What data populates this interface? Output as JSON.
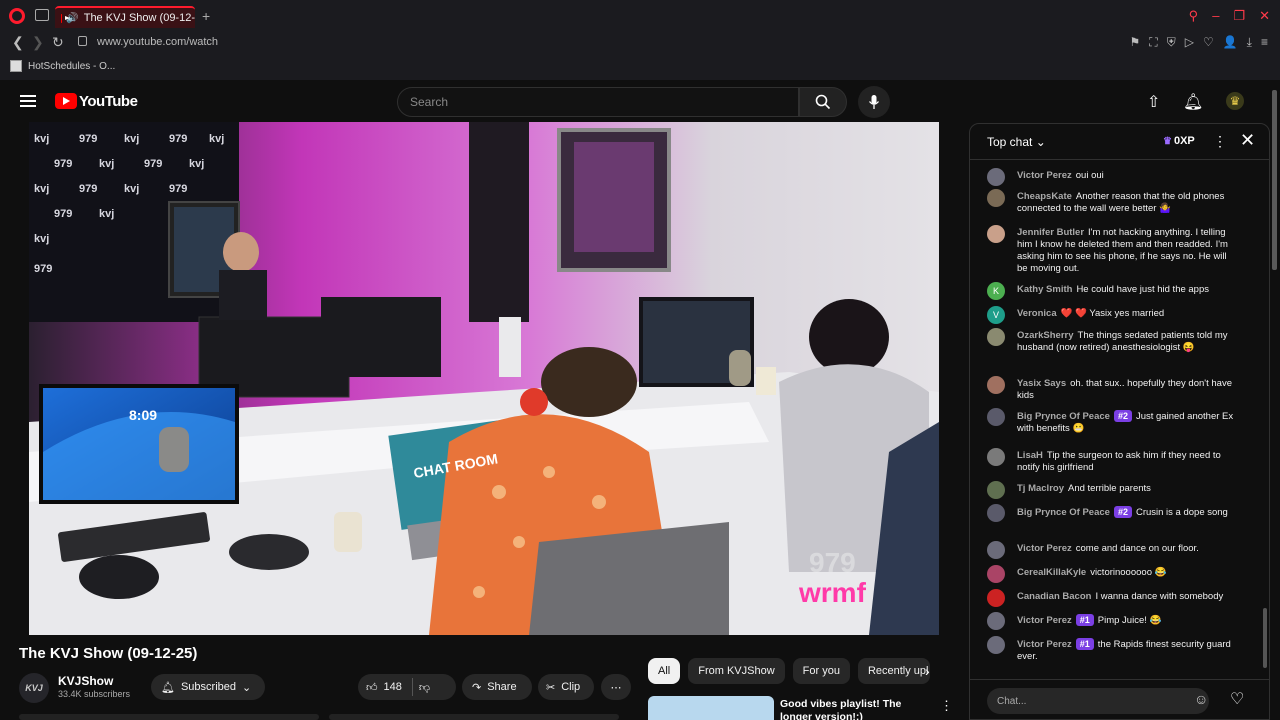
{
  "browser": {
    "tab_title": "The KVJ Show (09-12-",
    "new_tab_glyph": "+",
    "url": "www.youtube.com/watch",
    "bookmark_label": "HotSchedules - O...",
    "accent": "#ff1b2d"
  },
  "header": {
    "wordmark": "YouTube",
    "search_placeholder": "Search"
  },
  "video": {
    "clock": "8:09",
    "laptop_sticker": "CHAT ROOM",
    "watermark_top": "979",
    "watermark_bottom": "wrmf"
  },
  "meta": {
    "title": "The KVJ Show (09-12-25)",
    "channel_avatar_text": "KVJ",
    "channel_name": "KVJShow",
    "subscribers": "33.4K subscribers",
    "subscribed_label": "Subscribed",
    "likes": "148",
    "share_label": "Share",
    "clip_label": "Clip"
  },
  "chips": [
    "All",
    "From KVJShow",
    "For you",
    "Recently upl"
  ],
  "recommendation": {
    "title": "Good vibes playlist! The longer version!:)"
  },
  "chat": {
    "mode_label": "Top chat",
    "xp_label": "0XP",
    "input_placeholder": "Chat...",
    "messages": [
      {
        "author": "Victor Perez",
        "text": "oui oui",
        "avatar_color": "#6b6b7a",
        "avatar_letter": ""
      },
      {
        "author": "CheapsKate",
        "text": "Another reason that the old phones connected to the wall were better 🤷‍♀️",
        "avatar_color": "#7a6a55",
        "avatar_letter": ""
      },
      {
        "author": "Jennifer Butler",
        "text": "I'm not hacking anything. I telling him I know he deleted them and then readded. I'm asking him to see his phone, if he says no. He will be moving out.",
        "avatar_color": "#c9a08a",
        "avatar_letter": ""
      },
      {
        "author": "Kathy Smith",
        "text": "He could have just hid the apps",
        "avatar_color": "#4caf50",
        "avatar_letter": "K"
      },
      {
        "author": "Veronica",
        "text": "❤️ ❤️  Yasix yes married",
        "avatar_color": "#1e9e8a",
        "avatar_letter": "V"
      },
      {
        "author": "OzarkSherry",
        "text": "The things sedated patients told my husband (now retired) anesthesiologist 😝",
        "avatar_color": "#8a8a70",
        "avatar_letter": ""
      },
      {
        "author": "Yasix Says",
        "text": "oh. that sux.. hopefully they don't have kids",
        "avatar_color": "#a07060",
        "avatar_letter": ""
      },
      {
        "author": "Big Prynce Of Peace",
        "badge": "#2",
        "text": "Just gained another Ex with benefits 😬",
        "avatar_color": "#5a5a6a",
        "avatar_letter": ""
      },
      {
        "author": "LisaH",
        "text": "Tip the surgeon to ask him if they need to notify his girlfriend",
        "avatar_color": "#7a7a7a",
        "avatar_letter": ""
      },
      {
        "author": "Tj Maclroy",
        "text": "And terrible parents",
        "avatar_color": "#5f6f50",
        "avatar_letter": ""
      },
      {
        "author": "Big Prynce Of Peace",
        "badge": "#2",
        "text": "Crusin is a dope song",
        "avatar_color": "#5a5a6a",
        "avatar_letter": ""
      },
      {
        "author": "Victor Perez",
        "text": "come and dance on our floor.",
        "avatar_color": "#6b6b7a",
        "avatar_letter": ""
      },
      {
        "author": "CerealKillaKyle",
        "text": "victorinoooooo 😂",
        "avatar_color": "#aa4466",
        "avatar_letter": ""
      },
      {
        "author": "Canadian Bacon",
        "text": "I wanna dance with somebody",
        "avatar_color": "#cc2222",
        "avatar_letter": ""
      },
      {
        "author": "Victor Perez",
        "badge": "#1",
        "text": "Pimp Juice! 😂",
        "avatar_color": "#6b6b7a",
        "avatar_letter": ""
      },
      {
        "author": "Victor Perez",
        "badge": "#1",
        "text": "the Rapids finest security guard ever.",
        "avatar_color": "#6b6b7a",
        "avatar_letter": ""
      }
    ]
  }
}
